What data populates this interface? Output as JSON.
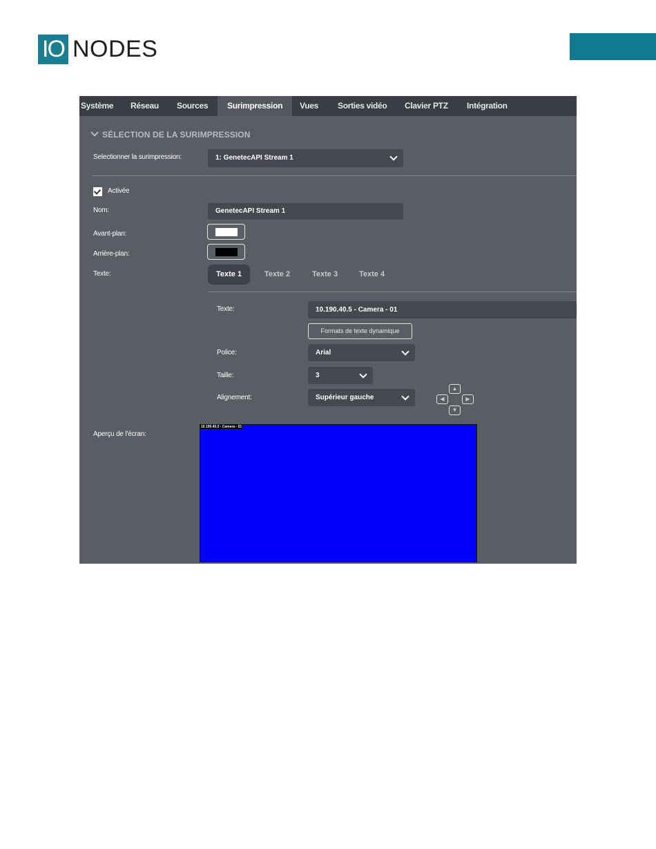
{
  "header": {
    "logo_mark": "IO",
    "logo_text": "NODES",
    "brand_color": "#107b90"
  },
  "nav": {
    "items": [
      "Système",
      "Réseau",
      "Sources",
      "Surimpression",
      "Vues",
      "Sorties vidéo",
      "Clavier PTZ",
      "Intégration"
    ],
    "active": "Surimpression"
  },
  "section": {
    "title": "SÉLECTION DE LA SURIMPRESSION",
    "select_label": "Selectionner la surimpression:",
    "select_value": "1: GenetecAPI Stream 1"
  },
  "form": {
    "enabled_label": "Activée",
    "enabled_checked": true,
    "name_label": "Nom:",
    "name_value": "GenetecAPI Stream 1",
    "foreground_label": "Avant-plan:",
    "foreground_color": "#ffffff",
    "background_label": "Arrière-plan:",
    "background_color": "#000000",
    "text_label": "Texte:"
  },
  "text_tabs": {
    "items": [
      "Texte 1",
      "Texte 2",
      "Texte 3",
      "Texte 4"
    ],
    "active": "Texte 1"
  },
  "text_settings": {
    "text_label": "Texte:",
    "text_value": "10.190.40.5 - Camera - 01",
    "dynamic_formats_button": "Formats de texte dynamique",
    "font_label": "Police:",
    "font_value": "Arial",
    "size_label": "Taille:",
    "size_value": "3",
    "alignment_label": "Alignement:",
    "alignment_value": "Supérieur gauche"
  },
  "preview": {
    "label": "Aperçu de l'écran:",
    "overlay_text": "10.190.40.5 - Camera - 01",
    "background_color": "#0000ff"
  }
}
